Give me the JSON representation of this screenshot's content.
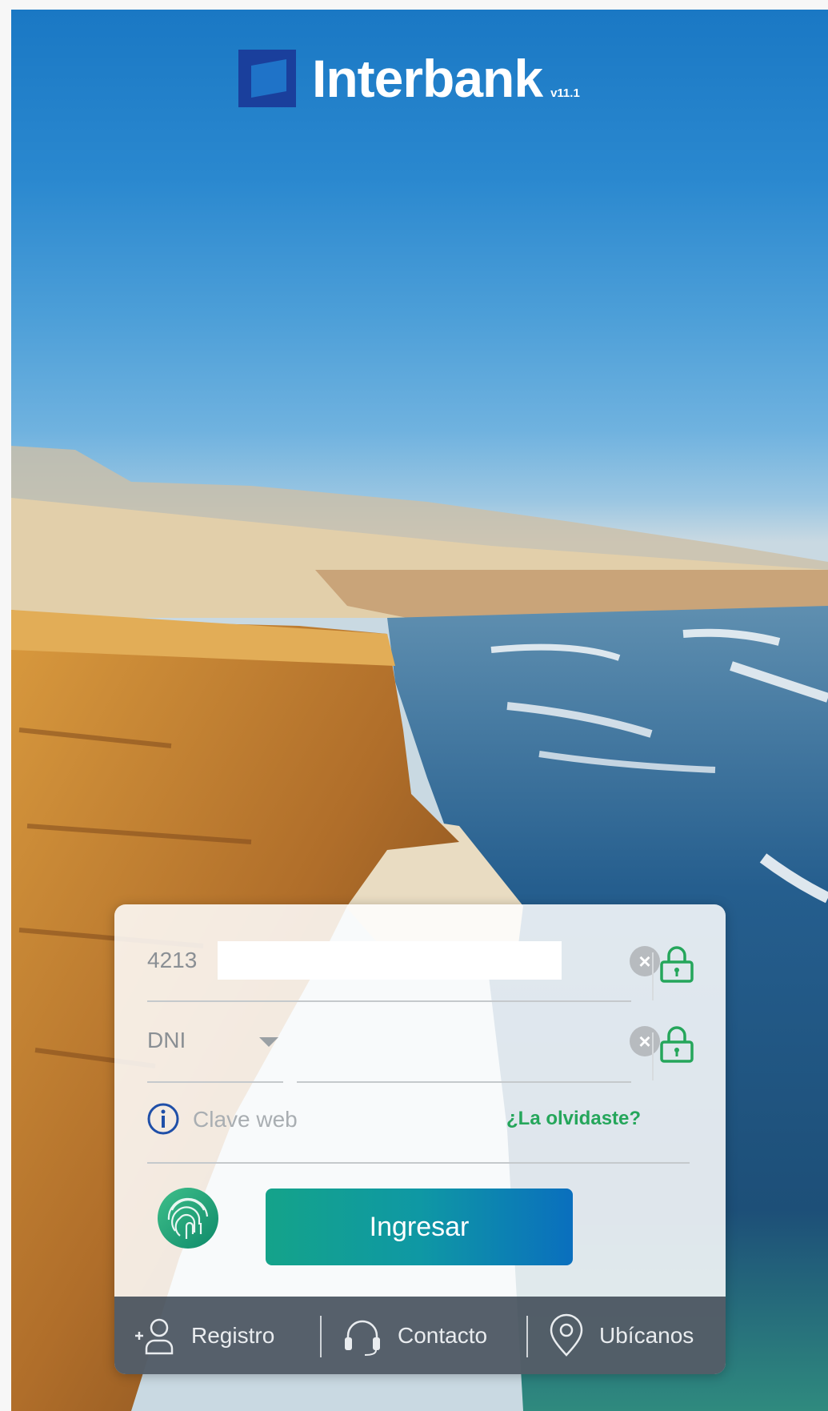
{
  "header": {
    "brand": "Interbank",
    "version": "v11.1"
  },
  "login_form": {
    "card_field": {
      "value": "4213"
    },
    "document_type": {
      "selected": "DNI"
    },
    "password": {
      "placeholder": "Clave web",
      "forgot_link": "¿La olvidaste?"
    },
    "submit_label": "Ingresar"
  },
  "bottom_bar": {
    "items": [
      {
        "label": "Registro",
        "icon": "add-user-icon"
      },
      {
        "label": "Contacto",
        "icon": "headset-icon"
      },
      {
        "label": "Ubícanos",
        "icon": "location-pin-icon"
      }
    ]
  },
  "colors": {
    "brand_blue": "#1a3f9c",
    "accent_green": "#25a65b",
    "button_start": "#14a38a",
    "button_end": "#0a6fbe"
  }
}
